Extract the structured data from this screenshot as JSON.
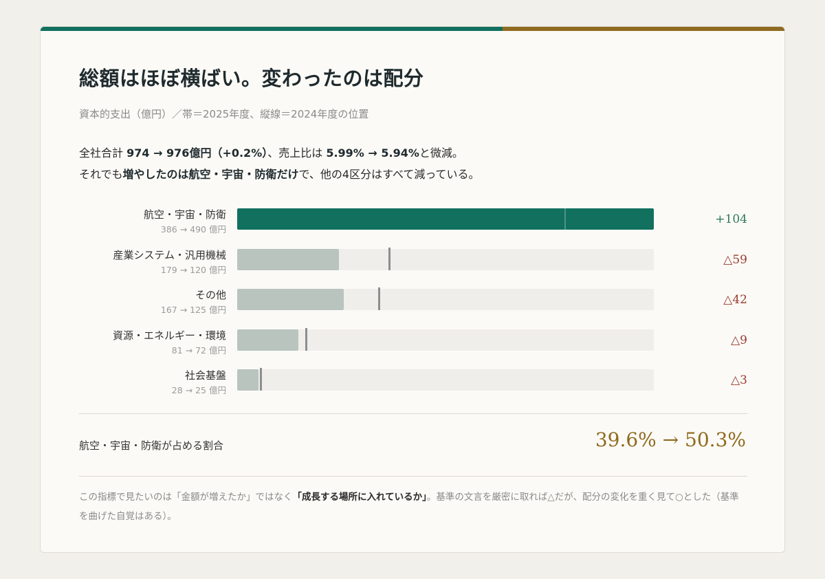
{
  "title": "総額はほぼ横ばい。変わったのは配分",
  "subtitle": "資本的支出（億円）／帯＝2025年度、縦線＝2024年度の位置",
  "lead": {
    "line1_a": "全社合計 ",
    "line1_b": "974 → 976億円（+0.2%）",
    "line1_c": "、売上比は ",
    "line1_d": "5.99% → 5.94%",
    "line1_e": "と微減。",
    "line2_a": "それでも",
    "line2_b": "増やしたのは航空・宇宙・防衛だけ",
    "line2_c": "で、他の4区分はすべて減っている。"
  },
  "colors": {
    "accent_green": "#12705f",
    "accent_gold": "#8f6a1f",
    "bar_grey": "#b9c4bf",
    "increase_text": "#2f7a5e",
    "decrease_text": "#9a3a30"
  },
  "chart_data": {
    "type": "bar",
    "orientation": "horizontal",
    "unit": "億円",
    "xlim": [
      0,
      490
    ],
    "series": [
      {
        "name": "2025年度",
        "values": [
          490,
          120,
          125,
          72,
          25
        ]
      },
      {
        "name": "2024年度",
        "values": [
          386,
          179,
          167,
          81,
          28
        ]
      }
    ],
    "rows": [
      {
        "label": "航空・宇宙・防衛",
        "sublabel": "386 → 490 億円",
        "v2024": 386,
        "v2025": 490,
        "delta": "+104",
        "increase": true
      },
      {
        "label": "産業システム・汎用機械",
        "sublabel": "179 → 120 億円",
        "v2024": 179,
        "v2025": 120,
        "delta": "△59",
        "increase": false
      },
      {
        "label": "その他",
        "sublabel": "167 → 125 億円",
        "v2024": 167,
        "v2025": 125,
        "delta": "△42",
        "increase": false
      },
      {
        "label": "資源・エネルギー・環境",
        "sublabel": "81 → 72 億円",
        "v2024": 81,
        "v2025": 72,
        "delta": "△9",
        "increase": false
      },
      {
        "label": "社会基盤",
        "sublabel": "28 → 25 億円",
        "v2024": 28,
        "v2025": 25,
        "delta": "△3",
        "increase": false
      }
    ]
  },
  "share": {
    "label": "航空・宇宙・防衛が占める割合",
    "value": "39.6% → 50.3%"
  },
  "note": {
    "a": "この指標で見たいのは「金額が増えたか」ではなく",
    "b": "「成長する場所に入れているか」",
    "c": "。基準の文言を厳密に取れば△だが、配分の変化を重く見て○とした（基準を曲げた自覚はある）。"
  }
}
